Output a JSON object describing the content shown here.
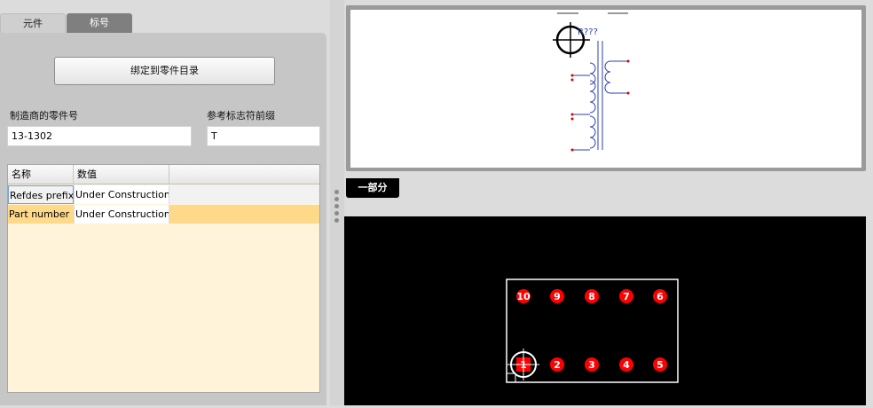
{
  "tabs": [
    {
      "label": "元件",
      "active": true
    },
    {
      "label": "标号",
      "active": false
    }
  ],
  "bind_button": {
    "label": "绑定到零件目录"
  },
  "mfr_part": {
    "label": "制造商的零件号",
    "value": "13-1302"
  },
  "refdes_prefix": {
    "label": "参考标志符前缀",
    "value": "T"
  },
  "properties_grid": {
    "columns": [
      "名称",
      "数值"
    ],
    "rows": [
      {
        "name": "Refdes prefix",
        "value": "Under Construction"
      },
      {
        "name": "Part number",
        "value": "Under Construction"
      }
    ]
  },
  "schematic": {
    "refdes": "R???"
  },
  "section_label": "一部分",
  "footprint": {
    "top_pins": [
      "10",
      "9",
      "8",
      "7",
      "6"
    ],
    "bottom_pins": [
      "1",
      "2",
      "3",
      "4",
      "5"
    ]
  },
  "colors": {
    "selected_row": "#ffd98a",
    "grid_bg": "#fff3d9",
    "pad": "#ff0000",
    "wire": "#2d3fb0"
  }
}
